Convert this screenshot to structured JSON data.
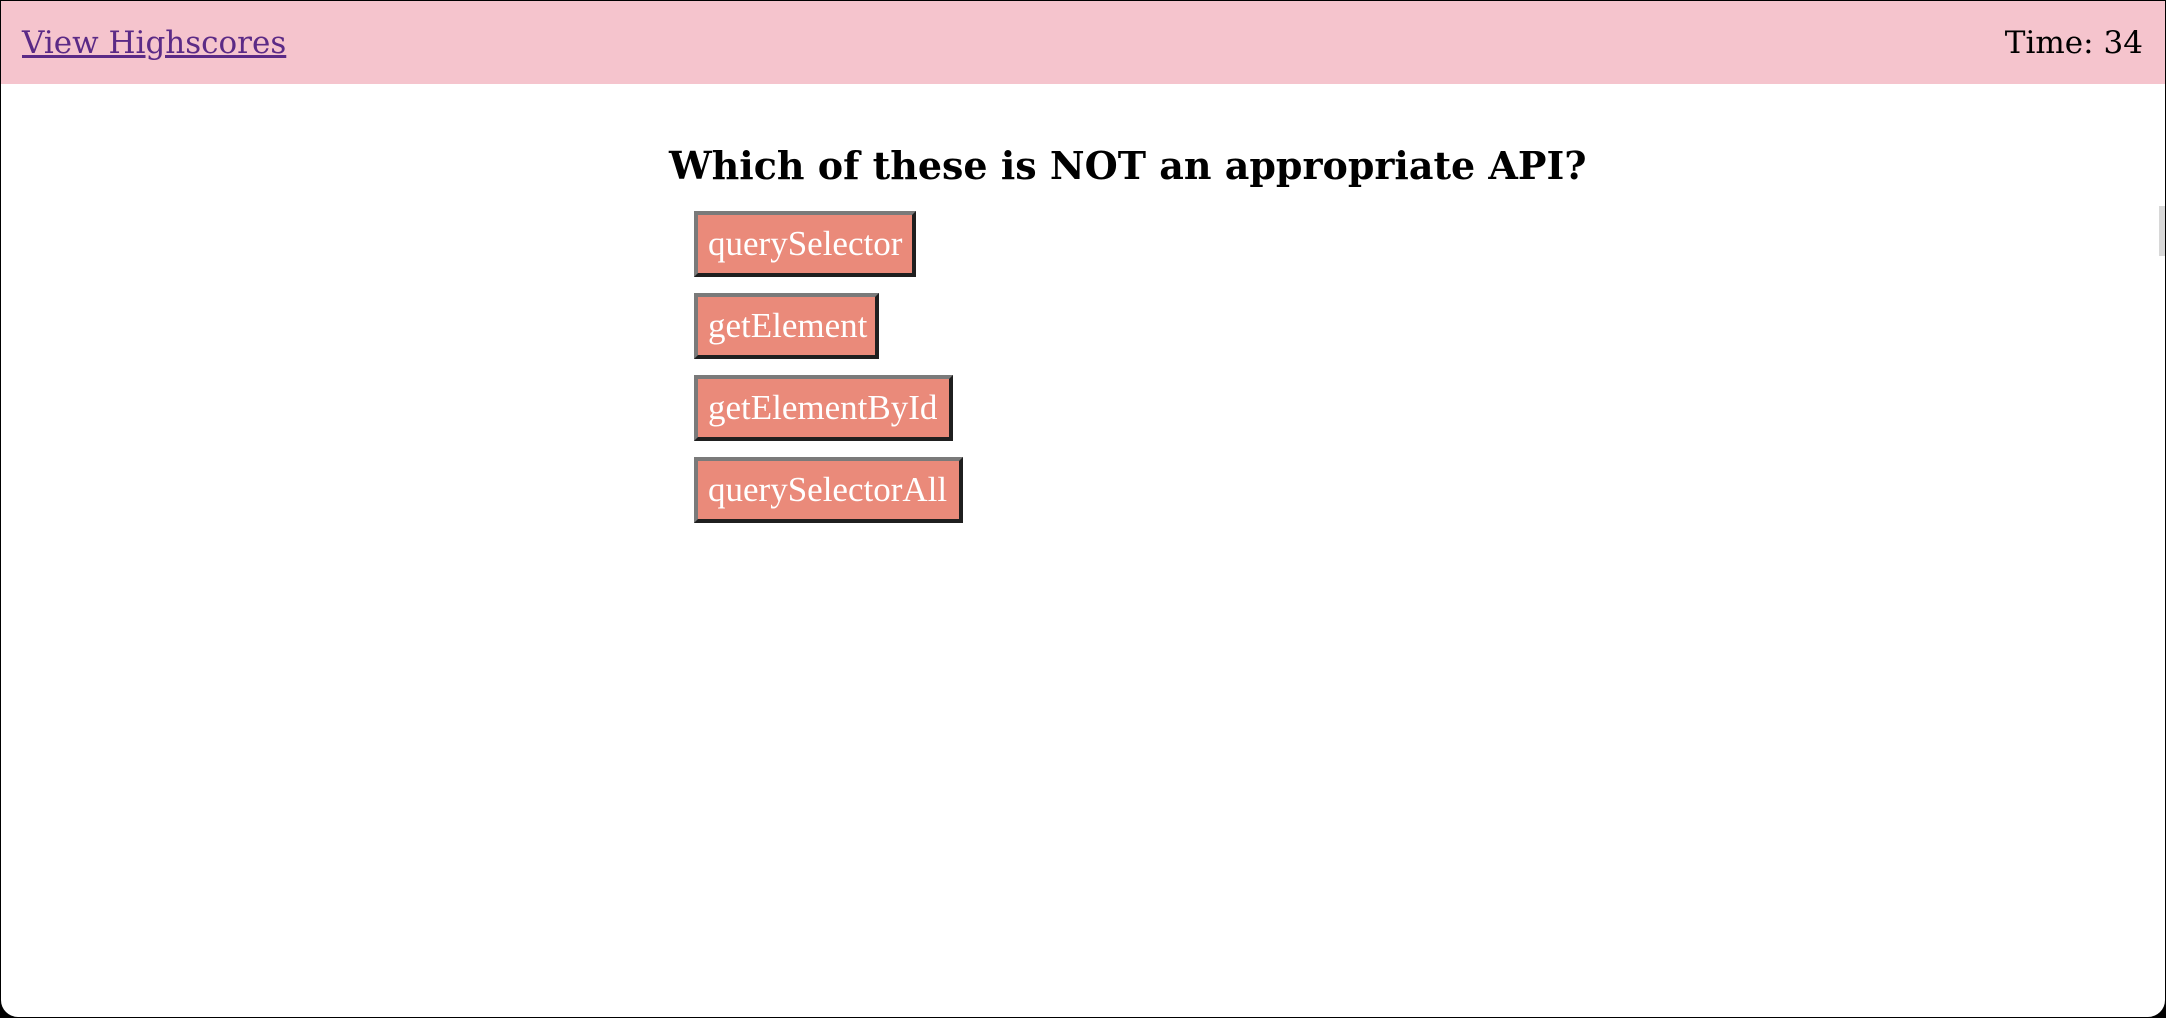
{
  "header": {
    "highscores_link": "View Highscores",
    "timer_label": "Time:",
    "timer_value": "34"
  },
  "quiz": {
    "question": "Which of these is NOT an appropriate API?",
    "choices": [
      {
        "label": "querySelector"
      },
      {
        "label": "getElement"
      },
      {
        "label": "getElementById"
      },
      {
        "label": "querySelectorAll"
      }
    ]
  },
  "colors": {
    "header_bg": "#f5c4cd",
    "link_color": "#5b2a86",
    "choice_bg": "#ea8a7a",
    "choice_text": "#ffffff"
  }
}
